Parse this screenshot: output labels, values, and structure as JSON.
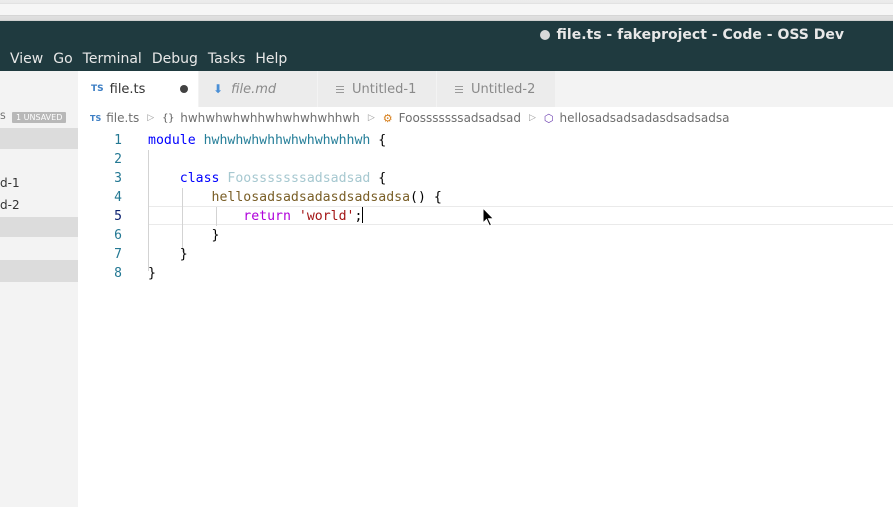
{
  "window": {
    "title": "file.ts - fakeproject - Code - OSS Dev"
  },
  "menubar": [
    "View",
    "Go",
    "Terminal",
    "Debug",
    "Tasks",
    "Help"
  ],
  "sidebar": {
    "unsaved_edge": "S",
    "unsaved_badge": "1 UNSAVED",
    "files": [
      "d-1",
      "d-2"
    ]
  },
  "tabs": [
    {
      "label": "file.ts",
      "icon": "ts-icon",
      "dirty": true,
      "active": true
    },
    {
      "label": "file.md",
      "icon": "markdown-icon",
      "active": false
    },
    {
      "label": "Untitled-1",
      "icon": "text-lines-icon",
      "active": false
    },
    {
      "label": "Untitled-2",
      "icon": "text-lines-icon",
      "active": false
    }
  ],
  "breadcrumbs": {
    "file": "file.ts",
    "namespace": "hwhwhwhwhhwhwhwhwhhwh",
    "class": "Foosssssssadsadsad",
    "method": "hellosadsadsadasdsadsadsa"
  },
  "editor": {
    "current_line": 5,
    "line_numbers": [
      "1",
      "2",
      "3",
      "4",
      "5",
      "6",
      "7",
      "8"
    ],
    "code": {
      "l1_kw": "module",
      "l1_name": "hwhwhwhwhhwhwhwhwhhwh",
      "l1_brace": " {",
      "l3_kw": "class",
      "l3_name": "Foosssssssadsadsad",
      "l3_brace": " {",
      "l4_name": "hellosadsadsadasdsadsadsa",
      "l4_rest": "() {",
      "l5_kw": "return",
      "l5_str": "'world'",
      "l5_semi": ";",
      "l6": "}",
      "l7": "}",
      "l8": "}"
    }
  },
  "colors": {
    "titlebar": "#1f3a3f",
    "keyword": "#0000ff",
    "control_keyword": "#af00db",
    "string": "#a31515",
    "method": "#795e26",
    "line_number": "#237893"
  }
}
